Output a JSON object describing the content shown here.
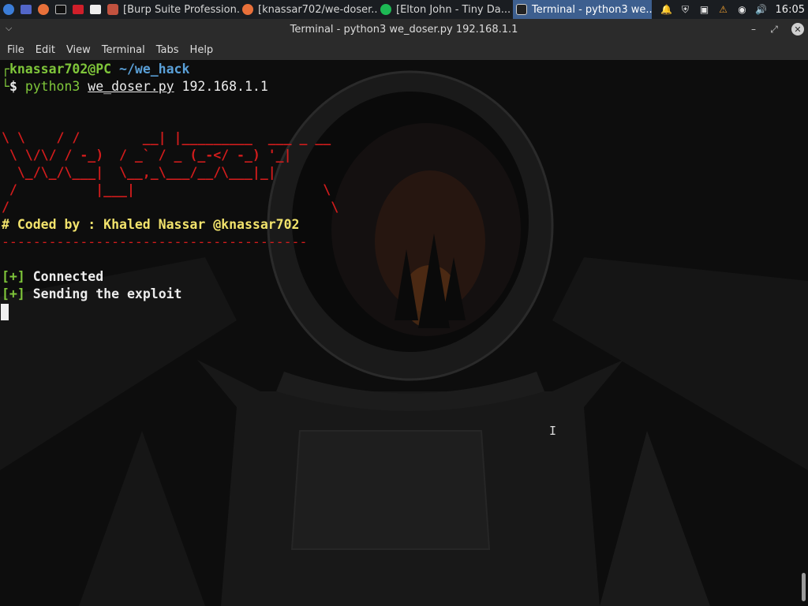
{
  "taskbar": {
    "tasks": [
      {
        "label": "[Burp Suite Profession...",
        "icon": "burp-icon",
        "color": "#c2523f"
      },
      {
        "label": "[knassar702/we-doser...",
        "icon": "firefox-icon",
        "color": "#e8703a"
      },
      {
        "label": "[Elton John - Tiny Da...",
        "icon": "spotify-icon",
        "color": "#1db954"
      },
      {
        "label": "Terminal - python3 we...",
        "icon": "terminal-icon",
        "color": "#222222"
      }
    ],
    "clock": "16:05"
  },
  "window": {
    "title": "Terminal - python3 we_doser.py 192.168.1.1"
  },
  "menubar": {
    "items": [
      "File",
      "Edit",
      "View",
      "Terminal",
      "Tabs",
      "Help"
    ]
  },
  "terminal": {
    "prompt_user": "knassar702@PC",
    "prompt_path": "~/we_hack",
    "prompt_symbol": "$",
    "command": "python3",
    "script": "we_doser.py",
    "argument": "192.168.1.1",
    "ascii_art": "\\ \\    / /        __| |_________  ___ _ __\n \\ \\/\\/ / -_)  / _` / _ (_-</ -_) '_|\n  \\_/\\_/\\___|  \\__,_\\___/__/\\___|_|\n /          |___|                        \\\n/                                         \\",
    "credit": "# Coded by : Khaled Nassar @knassar702",
    "separator": "---------------------------------------",
    "status": [
      {
        "marker": "[+]",
        "text": "Connected"
      },
      {
        "marker": "[+]",
        "text": "Sending the exploit"
      }
    ]
  },
  "colors": {
    "accent": "#3d5f8f",
    "prompt_green": "#7fc63a",
    "path_blue": "#5aa0d8",
    "banner_red": "#d21c1c",
    "credit_yellow": "#f2e36c"
  }
}
